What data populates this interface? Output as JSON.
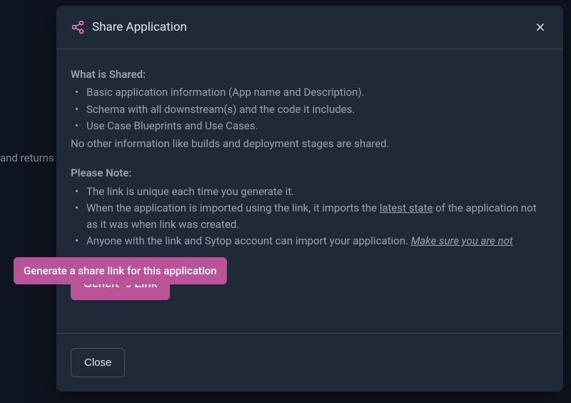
{
  "background": {
    "truncated_text": "and returns"
  },
  "modal": {
    "title": "Share Application",
    "shared_heading": "What is Shared:",
    "shared_items": [
      "Basic application information (App name and Description).",
      "Schema with all downstream(s) and the code it includes.",
      "Use Case Blueprints and Use Cases."
    ],
    "shared_footer": "No other information like builds and deployment stages are shared.",
    "note_heading": "Please Note:",
    "note_items": {
      "0": "The link is unique each time you generate it.",
      "1_pre": "When the application is imported using the link, it imports the ",
      "1_underline": "latest state",
      "1_post": " of the application not as it was when link was created.",
      "2_pre": "Anyone with the link and Sytop account can import your application. ",
      "2_italic": "Make sure you are not"
    },
    "generate_label": "Generate Link",
    "close_label": "Close"
  },
  "tooltip": {
    "text": "Generate a share link for this application"
  },
  "colors": {
    "accent": "#b95499",
    "modal_bg": "#1f2937",
    "text_muted": "#9ca3af"
  }
}
